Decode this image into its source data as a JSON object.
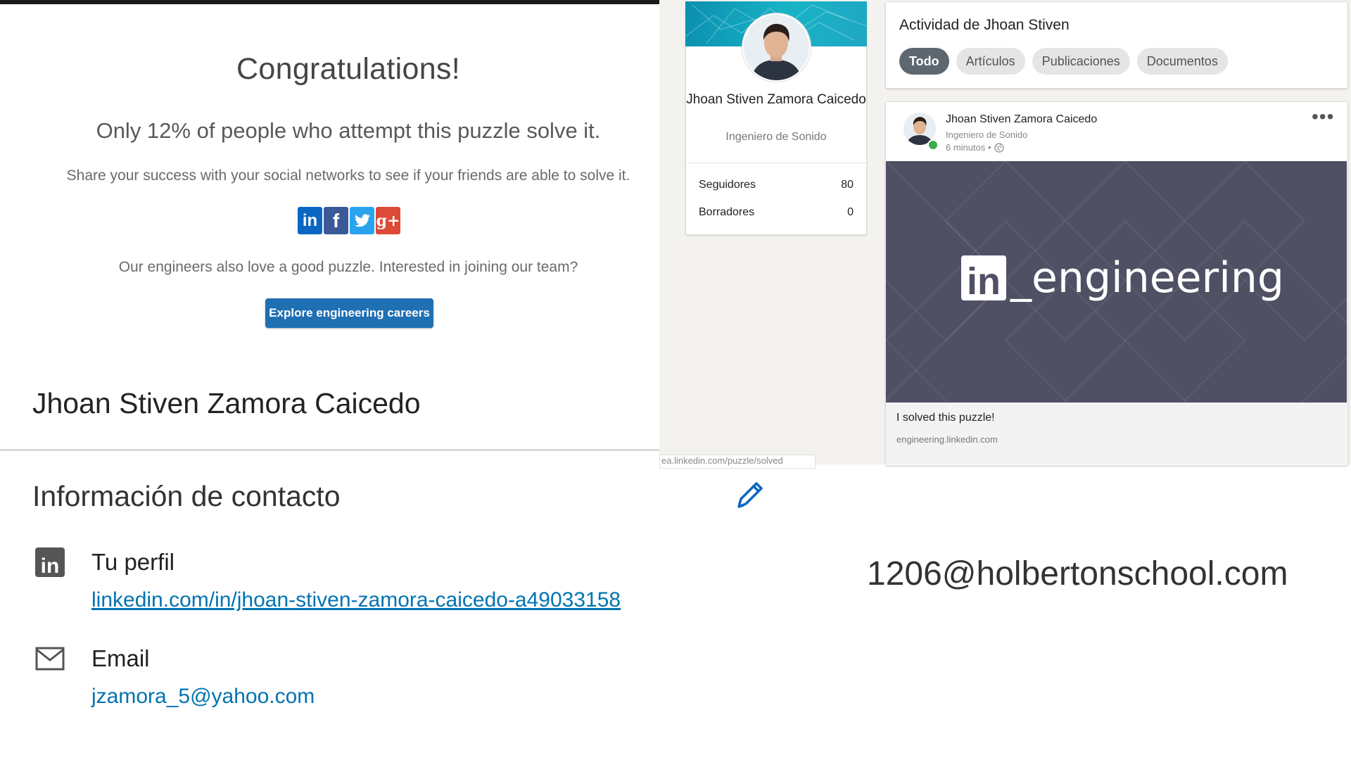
{
  "puzzle": {
    "title": "Congratulations!",
    "stat_line": "Only 12% of people who attempt this puzzle solve it.",
    "share_line": "Share your success with your social networks to see if your friends are able to solve it.",
    "social": [
      {
        "name": "linkedin-share-icon",
        "glyph": "in"
      },
      {
        "name": "facebook-share-icon",
        "glyph": "f"
      },
      {
        "name": "twitter-share-icon",
        "glyph": "bird"
      },
      {
        "name": "google-plus-share-icon",
        "glyph": "g+"
      }
    ],
    "engineers_line": "Our engineers also love a good puzzle. Interested in joining our team?",
    "careers_button": "Explore engineering careers",
    "profile_name": "Jhoan Stiven Zamora Caicedo"
  },
  "profile_card": {
    "name": "Jhoan Stiven Zamora Caicedo",
    "headline": "Ingeniero de Sonido",
    "stats": [
      {
        "label": "Seguidores",
        "value": "80"
      },
      {
        "label": "Borradores",
        "value": "0"
      }
    ]
  },
  "activity": {
    "title": "Actividad de Jhoan Stiven",
    "tabs": [
      "Todo",
      "Artículos",
      "Publicaciones",
      "Documentos"
    ],
    "active_tab": "Todo"
  },
  "post": {
    "author": "Jhoan Stiven Zamora Caicedo",
    "headline": "Ingeniero de Sonido",
    "time": "6 minutos •",
    "menu": "•••",
    "banner_logo": "in",
    "banner_text": "_engineering",
    "caption": "I solved this puzzle!",
    "link": "engineering.linkedin.com",
    "status_url": "ea.linkedin.com/puzzle/solved"
  },
  "contact": {
    "title": "Información de contacto",
    "profile_label": "Tu perfil",
    "profile_url": "linkedin.com/in/jhoan-stiven-zamora-caicedo-a49033158",
    "email_label": "Email",
    "email_value": "jzamora_5@yahoo.com",
    "school_email": "1206@holbertonschool.com"
  },
  "colors": {
    "linkedin_blue": "#0a66c2",
    "facebook_blue": "#3b5998",
    "twitter_blue": "#2aa3ef",
    "google_red": "#dc4a38",
    "button_blue": "#1f6fb3",
    "link_blue": "#0073b1",
    "online_green": "#3daa4b"
  }
}
